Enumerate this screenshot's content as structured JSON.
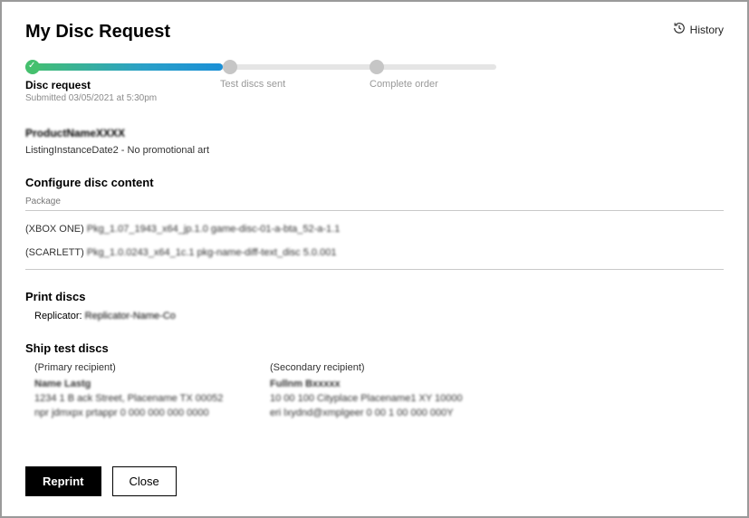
{
  "header": {
    "title": "My Disc Request",
    "history_label": "History"
  },
  "progress": {
    "fill_percent": 42,
    "steps": [
      {
        "label": "Disc request",
        "sub": "Submitted 03/05/2021 at 5:30pm",
        "active": true,
        "pos": 0
      },
      {
        "label": "Test discs sent",
        "sub": "",
        "active": false,
        "pos": 42
      },
      {
        "label": "Complete order",
        "sub": "",
        "active": false,
        "pos": 73
      }
    ]
  },
  "listing": {
    "title_blurred": "ProductNameXXXX",
    "subtitle": "ListingInstanceDate2 - No promotional art"
  },
  "configure": {
    "heading": "Configure disc content",
    "col_label": "Package",
    "packages": [
      {
        "platform": "(XBOX ONE)",
        "blurred": "Pkg_1.07_1943_x64_jp.1.0 game-disc-01-a-bta_52-a-1.1"
      },
      {
        "platform": "(SCARLETT)",
        "blurred": "Pkg_1.0.0243_x64_1c.1 pkg-name-diff-text_disc 5.0.001"
      }
    ]
  },
  "print": {
    "heading": "Print discs",
    "replicator_label": "Replicator:",
    "replicator_value_blurred": "Replicator-Name-Co"
  },
  "ship": {
    "heading": "Ship test discs",
    "columns": [
      {
        "head": "(Primary recipient)",
        "lines": [
          "Name Lastg",
          "1234  1 B ack Street, Placename TX 00052",
          "npr jdmxpx  prtappr   0 000 000  000 0000"
        ]
      },
      {
        "head": "(Secondary recipient)",
        "lines": [
          "Fullnm Bxxxxx",
          "10 00  100 Cityplace Placename1  XY 10000",
          "eri lxydnd@xmplgeer   0 00 1 00 000 000Y"
        ]
      }
    ]
  },
  "footer": {
    "reprint": "Reprint",
    "close": "Close"
  }
}
